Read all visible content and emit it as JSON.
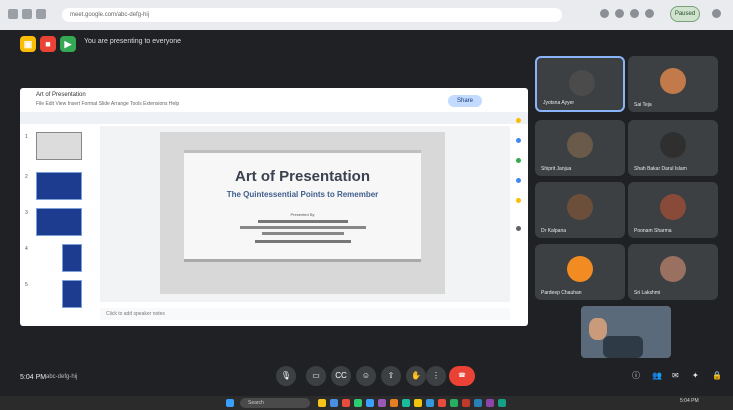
{
  "browser": {
    "url": "meet.google.com/abc-defg-hij",
    "profile_label": "Paused"
  },
  "meet": {
    "presenting_label": "You are presenting to everyone",
    "time": "5:04 PM",
    "meeting_code": "abc-defg-hij",
    "end_call_icon": "phone-hangup-icon"
  },
  "slides": {
    "doc_title": "Art of Presentation",
    "menu": "File  Edit  View  Insert  Format  Slide  Arrange  Tools  Extensions  Help",
    "share_label": "Share",
    "slide_title": "Art of Presentation",
    "slide_subtitle": "The Quintessential Points to Remember",
    "presented_by": "Presented By",
    "speaker_notes": "Click to add speaker notes",
    "thumb_numbers": [
      "1",
      "2",
      "3",
      "4",
      "5"
    ]
  },
  "participants": [
    {
      "name": "Jyotsna Ayyer",
      "face": "#4b4b4b"
    },
    {
      "name": "Sai Teja",
      "face": "#c27a4a"
    },
    {
      "name": "Shiprit Janjua",
      "face": "#6a5a4a"
    },
    {
      "name": "Shah Bakar Darul Islam",
      "face": "#2f2f2f"
    },
    {
      "name": "Dr Kalpana",
      "face": "#6b4f3a"
    },
    {
      "name": "Poonam Sharma",
      "face": "#8a4a3a"
    },
    {
      "name": "Pardeep Chauhan",
      "face": "#f28b22"
    },
    {
      "name": "Sri Lakshmi",
      "face": "#9a7060"
    }
  ],
  "taskbar": {
    "search_label": "Search",
    "clock": "5:04 PM"
  },
  "colors": {
    "accent": "#8ab4f8",
    "end_call": "#ea4335",
    "slide_title": "#3a4250",
    "slide_subtitle": "#3f5e8c"
  }
}
